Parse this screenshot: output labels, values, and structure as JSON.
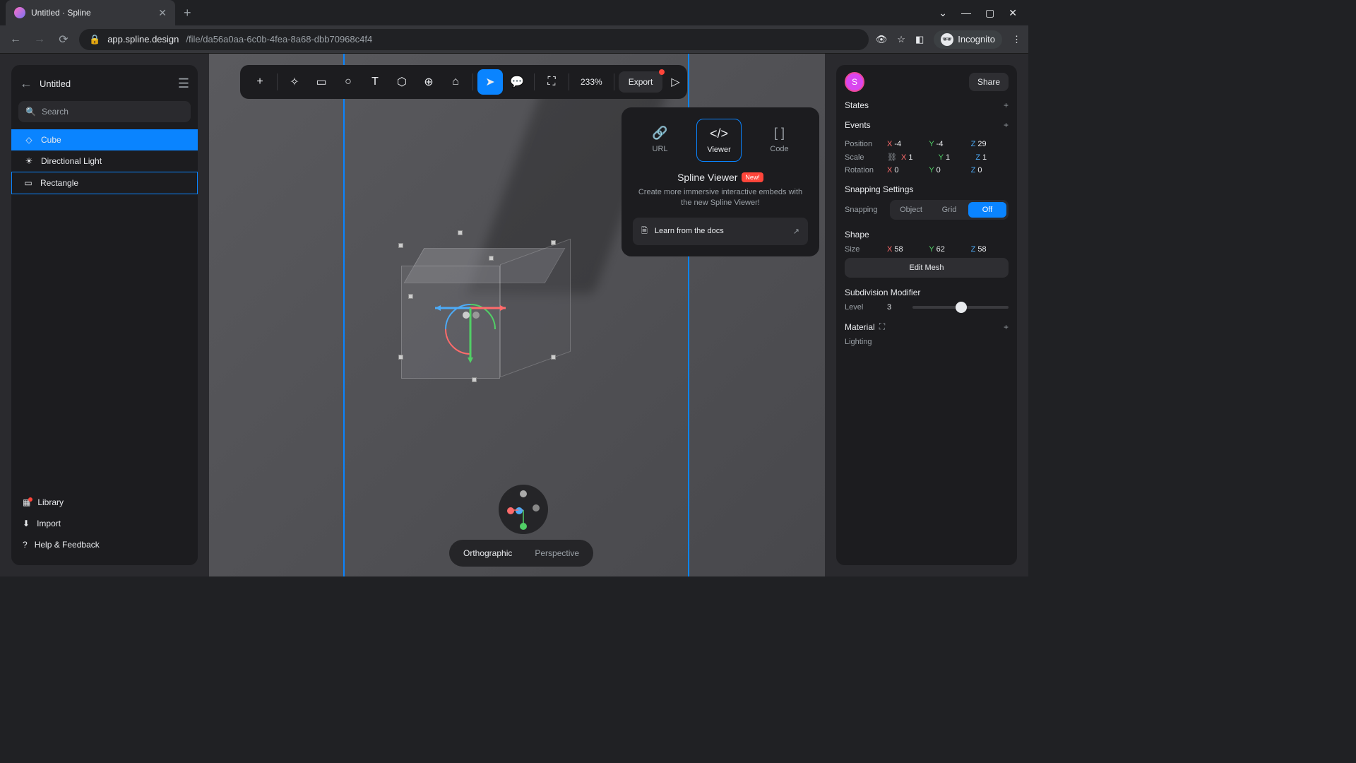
{
  "browser": {
    "tab_title": "Untitled · Spline",
    "url_prefix": "app.spline.design",
    "url_path": "/file/da56a0aa-6c0b-4fea-8a68-dbb70968c4f4",
    "incognito_label": "Incognito"
  },
  "left": {
    "doc_title": "Untitled",
    "search_placeholder": "Search",
    "layers": [
      {
        "name": "Cube",
        "selected": true
      },
      {
        "name": "Directional Light",
        "selected": false
      },
      {
        "name": "Rectangle",
        "selected": false,
        "outlined": true
      }
    ],
    "footer": {
      "library": "Library",
      "import": "Import",
      "help": "Help & Feedback"
    }
  },
  "toolbar": {
    "zoom": "233%",
    "export": "Export"
  },
  "popover": {
    "tabs": {
      "url": "URL",
      "viewer": "Viewer",
      "code": "Code"
    },
    "title": "Spline Viewer",
    "badge": "New!",
    "desc": "Create more immersive interactive embeds with the new Spline Viewer!",
    "link": "Learn from the docs"
  },
  "right": {
    "avatar": "S",
    "share": "Share",
    "states_label": "States",
    "events_label": "Events",
    "position_label": "Position",
    "scale_label": "Scale",
    "rotation_label": "Rotation",
    "position": {
      "x": "-4",
      "y": "-4",
      "z": "29"
    },
    "scale": {
      "x": "1",
      "y": "1",
      "z": "1"
    },
    "rotation": {
      "x": "0",
      "y": "0",
      "z": "0"
    },
    "snapping_label": "Snapping Settings",
    "snapping_row_label": "Snapping",
    "snapping_opts": {
      "object": "Object",
      "grid": "Grid",
      "off": "Off"
    },
    "shape_label": "Shape",
    "size_label": "Size",
    "size": {
      "x": "58",
      "y": "62",
      "z": "58"
    },
    "edit_mesh": "Edit Mesh",
    "subdiv_label": "Subdivision Modifier",
    "level_label": "Level",
    "level_val": "3",
    "material_label": "Material",
    "lighting_label": "Lighting"
  },
  "canvas": {
    "projection": {
      "ortho": "Orthographic",
      "persp": "Perspective"
    }
  }
}
